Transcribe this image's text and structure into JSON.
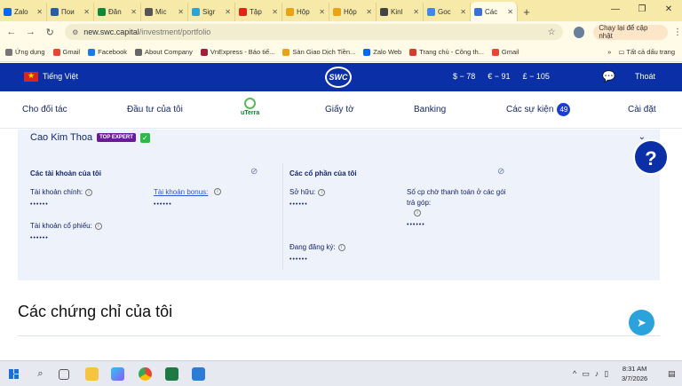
{
  "browser": {
    "tabs": [
      {
        "label": "Zalo",
        "color": "#0068ff"
      },
      {
        "label": "Пои",
        "color": "#2b5cab"
      },
      {
        "label": "Đăn",
        "color": "#0a8a3a"
      },
      {
        "label": "Mic",
        "color": "#555555"
      },
      {
        "label": "Sigr",
        "color": "#2aa3dd"
      },
      {
        "label": "Tập",
        "color": "#e62117"
      },
      {
        "label": "Hộp",
        "color": "#e8a317"
      },
      {
        "label": "Hộp",
        "color": "#e8a317"
      },
      {
        "label": "Kinl",
        "color": "#444444"
      },
      {
        "label": "Goc",
        "color": "#4285f4"
      },
      {
        "label": "Các",
        "color": "#3b6fd6",
        "active": true
      }
    ],
    "new_tab": "+",
    "url_host": "new.swc.capital",
    "url_path": "/investment/portfolio",
    "update_button": "Chạy lại để cập nhật",
    "bookmarks": [
      {
        "label": "Ứng dụng",
        "color": "#777777"
      },
      {
        "label": "Gmail",
        "color": "#ea4335"
      },
      {
        "label": "Facebook",
        "color": "#1877f2"
      },
      {
        "label": "About Company",
        "color": "#666666"
      },
      {
        "label": "VnExpress - Báo tiế...",
        "color": "#a61c3c"
      },
      {
        "label": "Sàn Giao Dịch Tiền...",
        "color": "#e8a317"
      },
      {
        "label": "Zalo Web",
        "color": "#0068ff"
      },
      {
        "label": "Trang chủ - Công th...",
        "color": "#d23f31"
      },
      {
        "label": "Gmail",
        "color": "#ea4335"
      }
    ],
    "bookmarks_more": "»",
    "all_bookmarks": "Tất cả dấu trang"
  },
  "site": {
    "language": "Tiếng Việt",
    "logo": "SWC",
    "rates": [
      "$ − 78",
      "€ − 91",
      "£ − 105"
    ],
    "logout": "Thoát",
    "nav": {
      "partners": "Cho đối tác",
      "my_investments": "Đầu tư của tôi",
      "uterra": "uTerra",
      "documents": "Giấy tờ",
      "banking": "Banking",
      "events": "Các sự kiện",
      "events_count": "49",
      "settings": "Cài đặt"
    }
  },
  "profile": {
    "name": "Cao Kim Thoa",
    "badge": "TOP EXPERT",
    "accounts_title": "Các tài khoản của tôi",
    "main_account_label": "Tài khoản chính:",
    "main_account_value": "••••••",
    "bonus_account_label": "Tài khoản bonus:",
    "bonus_account_value": "••••••",
    "stock_account_label": "Tài khoản cổ phiếu:",
    "stock_account_value": "••••••",
    "shares_title": "Các cổ phần của tôi",
    "owned_label": "Sở hữu:",
    "owned_value": "••••••",
    "pending_label_1": "Số cp chờ thanh toán ở các gói",
    "pending_label_2": "trả góp:",
    "pending_value": "••••••",
    "registered_label": "Đang đăng ký:",
    "registered_value": "••••••"
  },
  "certificates_title": "Các chứng chỉ của tôi",
  "help_button": "?",
  "taskbar": {
    "time": "8:31 AM",
    "date": "3/7/2026"
  }
}
